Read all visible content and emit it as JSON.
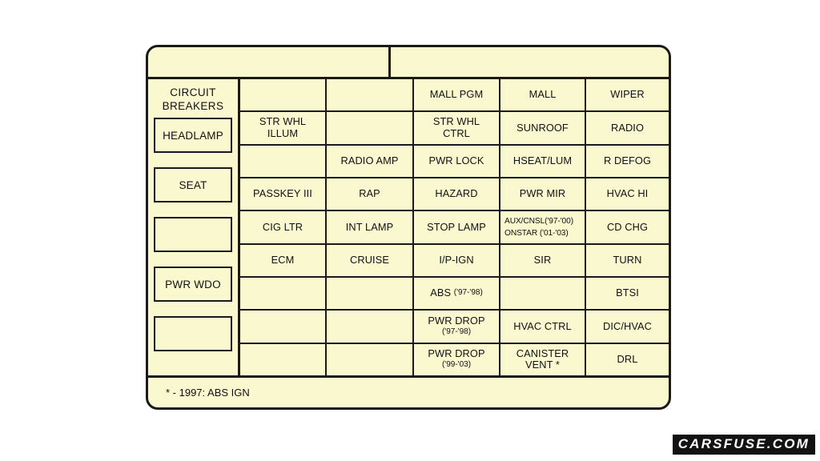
{
  "diagram": {
    "title_rows": [
      {
        "left": "",
        "right": ""
      }
    ],
    "breaker_column": {
      "title": "CIRCUIT\nBREAKERS",
      "boxes": [
        {
          "label": "HEADLAMP"
        },
        {
          "label": "SEAT"
        },
        {
          "label": ""
        },
        {
          "label": "PWR WDO"
        },
        {
          "label": ""
        }
      ]
    },
    "fuse_rows": [
      [
        "",
        "",
        "MALL PGM",
        "MALL",
        "WIPER"
      ],
      [
        "STR WHL\nILLUM",
        "",
        "STR WHL\nCTRL",
        "SUNROOF",
        "RADIO"
      ],
      [
        "",
        "RADIO AMP",
        "PWR LOCK",
        "HSEAT/LUM",
        "R DEFOG"
      ],
      [
        "PASSKEY III",
        "RAP",
        "HAZARD",
        "PWR MIR",
        "HVAC HI"
      ],
      [
        "CIG LTR",
        "INT LAMP",
        "STOP LAMP",
        "",
        "CD CHG"
      ],
      [
        "ECM",
        "CRUISE",
        "I/P-IGN",
        "SIR",
        "TURN"
      ],
      [
        "",
        "",
        "",
        "",
        "BTSI"
      ],
      [
        "",
        "",
        "",
        "HVAC CTRL",
        "DIC/HVAC"
      ],
      [
        "",
        "",
        "",
        "CANISTER\nVENT *",
        "DRL"
      ]
    ],
    "special_cells": {
      "aux_cnsl_line1": "AUX/CNSL('97-'00)",
      "aux_cnsl_line2": "ONSTAR  ('01-'03)",
      "abs_label": "ABS",
      "abs_years": "('97-'98)",
      "pwr_drop_label": "PWR DROP",
      "pwr_drop_years_1": "('97-'98)",
      "pwr_drop_years_2": "('99-'03)"
    },
    "footnote": "* - 1997: ABS IGN",
    "watermark": "CARSFUSE.COM",
    "colors": {
      "panel_fill": "#f9f8cf",
      "line": "#1a1a1a",
      "page_background": "#ffffff"
    }
  }
}
